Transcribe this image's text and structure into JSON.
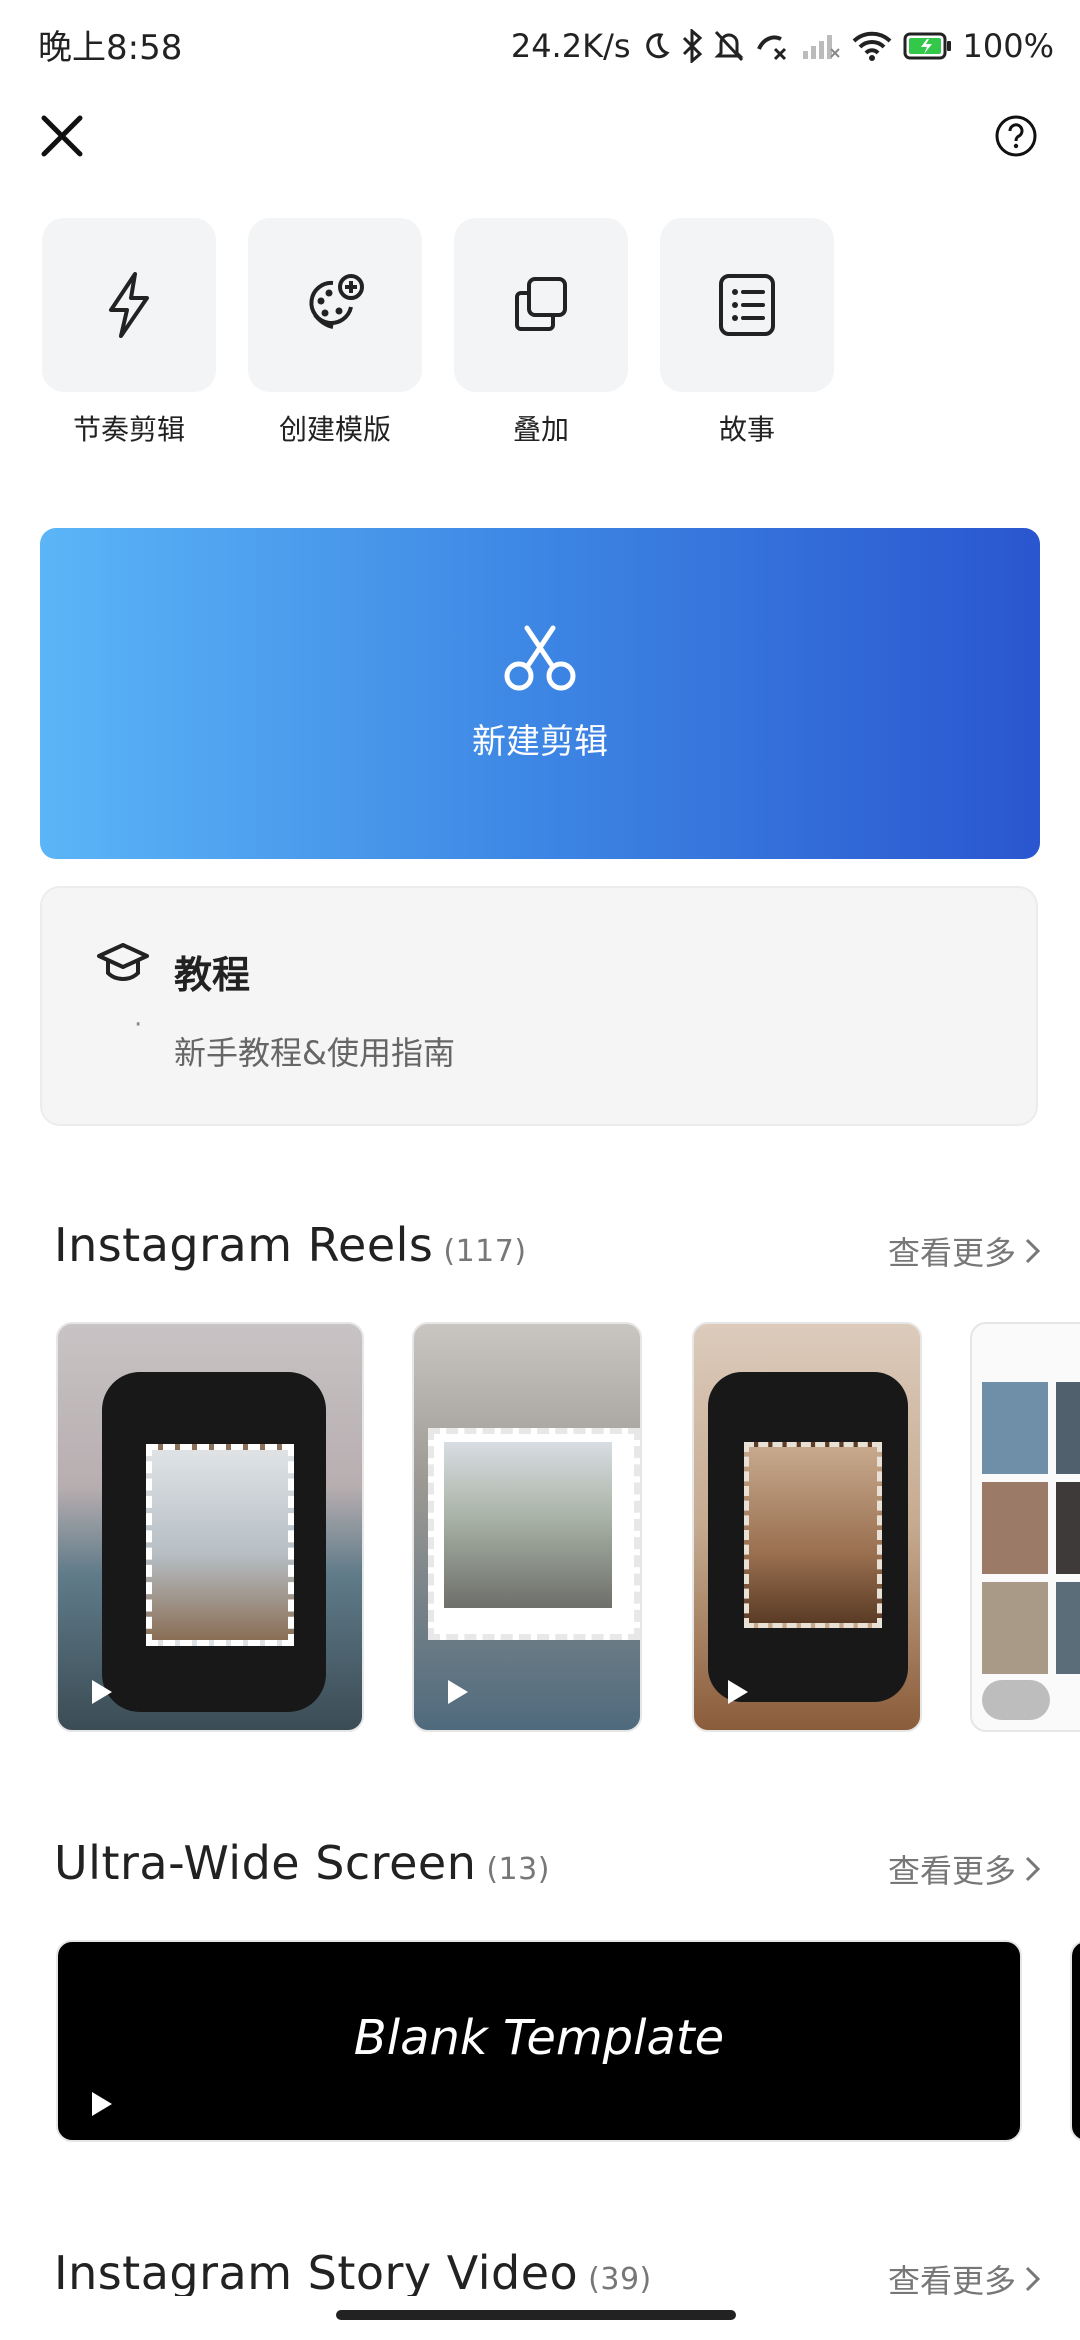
{
  "status_bar": {
    "time": "晚上8:58",
    "speed": "24.2K/s",
    "battery": "100%"
  },
  "tools": [
    {
      "label": "节奏剪辑",
      "icon": "lightning-icon"
    },
    {
      "label": "创建模版",
      "icon": "palette-add-icon"
    },
    {
      "label": "叠加",
      "icon": "overlay-icon"
    },
    {
      "label": "故事",
      "icon": "list-icon"
    }
  ],
  "new_edit": {
    "label": "新建剪辑"
  },
  "tutorial": {
    "title": "教程",
    "bullet": "·",
    "item": "新手教程&使用指南"
  },
  "sections": [
    {
      "title": "Instagram Reels",
      "count": "(117)",
      "more": "查看更多"
    },
    {
      "title": "Ultra-Wide Screen",
      "count": "(13)",
      "more": "查看更多"
    },
    {
      "title": "Instagram Story Video",
      "count": "(39)",
      "more": "查看更多"
    }
  ],
  "ultra_wide": {
    "card_text": "Blank Template"
  },
  "colors": {
    "accent_start": "#5bb5f7",
    "accent_end": "#2a56cf",
    "battery_green": "#34c84a"
  }
}
